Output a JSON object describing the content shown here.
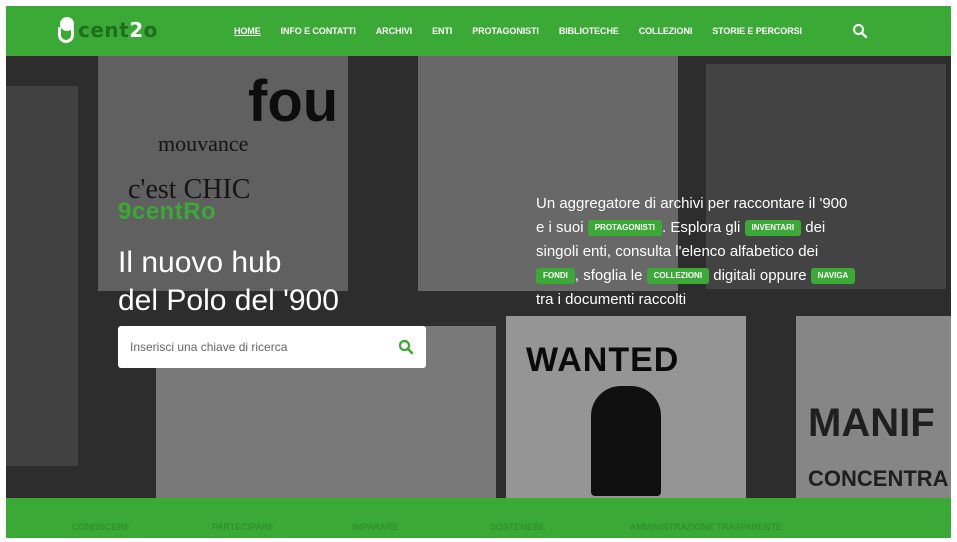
{
  "brand": {
    "logo_text_pre": "cent",
    "logo_text_accent": "2",
    "logo_text_post": "o"
  },
  "nav": {
    "items": [
      {
        "label": "HOME",
        "active": true
      },
      {
        "label": "INFO E CONTATTI"
      },
      {
        "label": "ARCHIVI"
      },
      {
        "label": "ENTI"
      },
      {
        "label": "PROTAGONISTI"
      },
      {
        "label": "BIBLIOTECHE"
      },
      {
        "label": "COLLEZIONI"
      },
      {
        "label": "STORIE E PERCORSI"
      }
    ],
    "search_icon": "search-icon"
  },
  "hero": {
    "brand_title": "9centRo",
    "title_line1": "Il nuovo hub",
    "title_line2": "del Polo del '900",
    "search": {
      "placeholder": "Inserisci una chiave di ricerca",
      "button_icon": "search-icon"
    },
    "description": {
      "t1": "Un aggregatore di archivi per raccontare il '900 e i suoi ",
      "tag1": "PROTAGONISTI",
      "t2": ". Esplora gli ",
      "tag2": "INVENTARI",
      "t3": " dei singoli enti, consulta l'elenco alfabetico dei ",
      "tag3": "FONDI",
      "t4": ", sfoglia le ",
      "tag4": "COLLEZIONI",
      "t5": " digitali oppure ",
      "tag5": "NAVIGA",
      "t6": " tra i documenti raccolti"
    },
    "posters": {
      "fou": "fou",
      "mouvance": "mouvance",
      "cest": "c'est CHIC",
      "wanted": "WANTED",
      "manif": "MANIF",
      "concentra": "CONCENTRA"
    }
  },
  "footer": {
    "items": [
      "CONOSCERE",
      "PARTECIPARE",
      "IMPARARE",
      "SOSTENERE",
      "AMMINISTRAZIONE TRASPARENTE"
    ]
  },
  "colors": {
    "accent": "#3aa935",
    "accent_dark": "#1e6f1c",
    "white": "#ffffff"
  }
}
